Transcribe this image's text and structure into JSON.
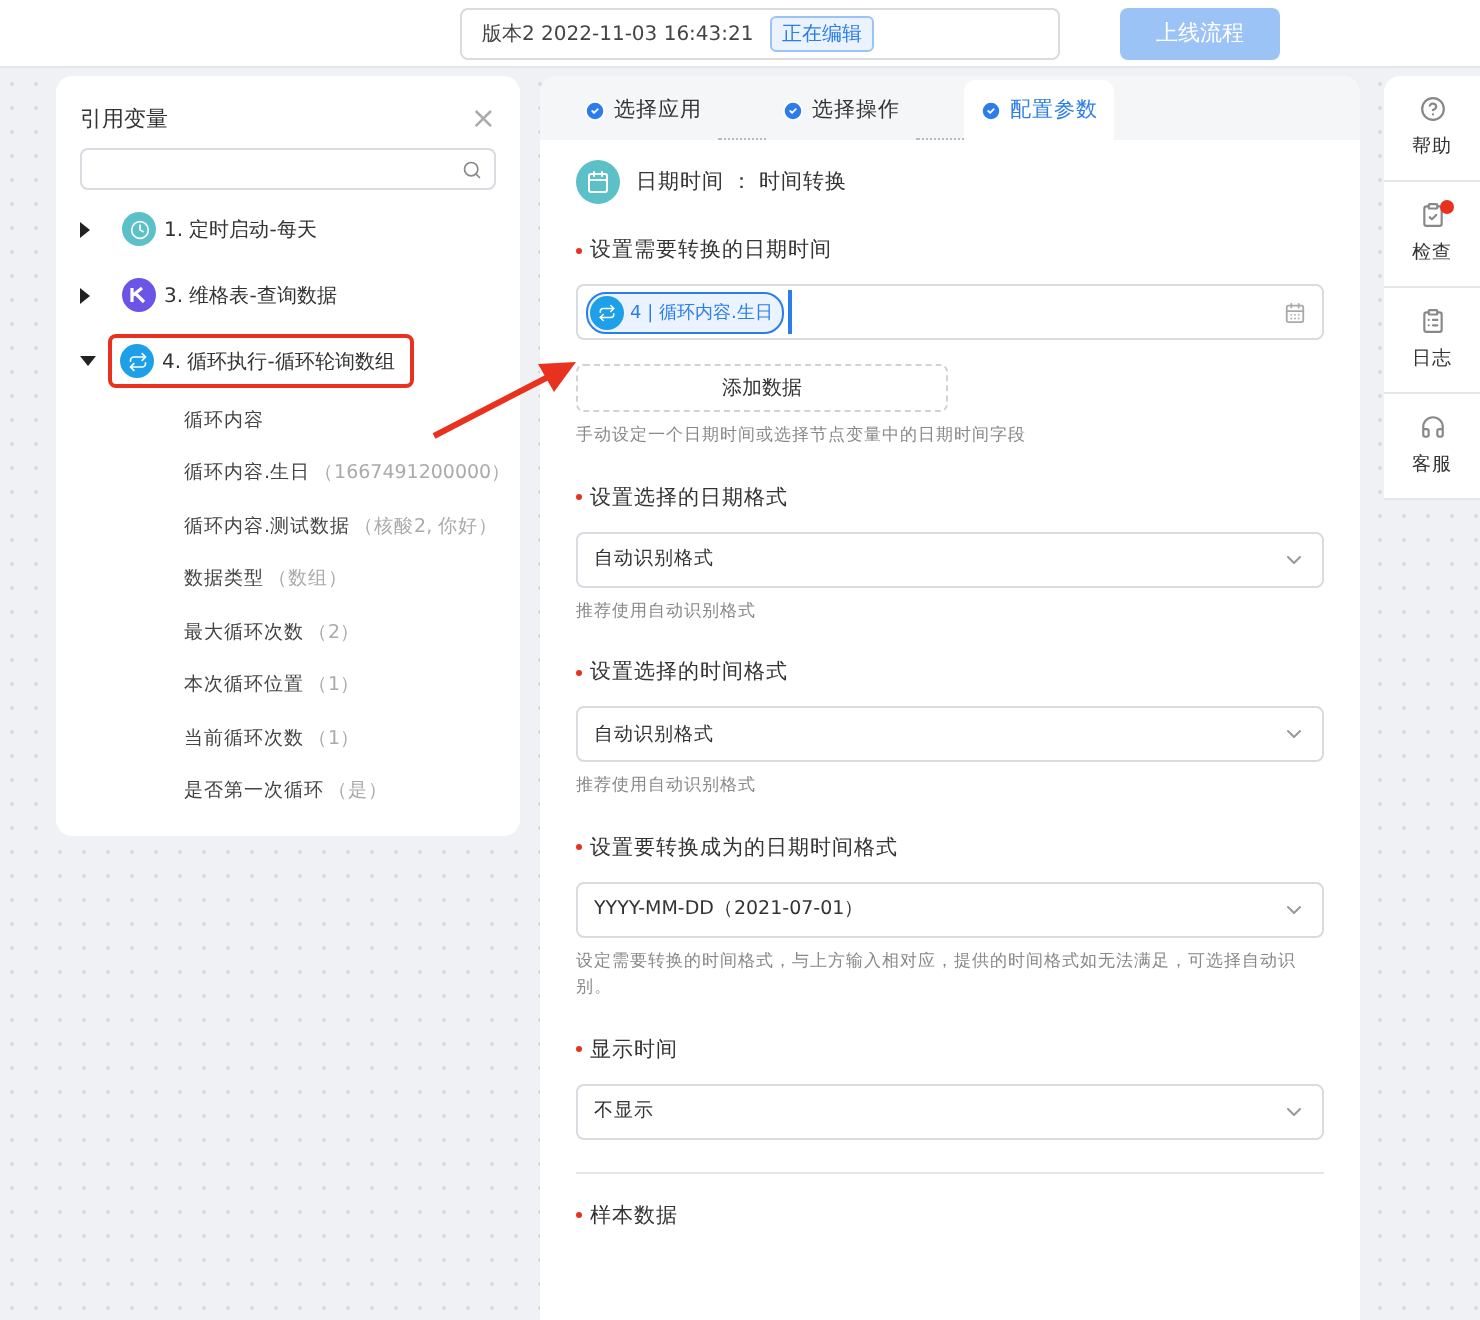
{
  "header": {
    "version": "版本2  2022-11-03 16:43:21",
    "status": "正在编辑",
    "publish_button": "上线流程"
  },
  "variables_panel": {
    "title": "引用变量",
    "close": "×",
    "nodes": [
      {
        "label": "1. 定时启动-每天",
        "kind": "timer",
        "expanded": false,
        "highlighted": false
      },
      {
        "label": "3. 维格表-查询数据",
        "kind": "table",
        "expanded": false,
        "highlighted": false
      },
      {
        "label": "4. 循环执行-循环轮询数组",
        "kind": "loop",
        "expanded": true,
        "highlighted": true,
        "children": [
          {
            "name": "循环内容"
          },
          {
            "name": "循环内容.生日",
            "value": "（1667491200000）"
          },
          {
            "name": "循环内容.测试数据",
            "value": "（核酸2, 你好）"
          },
          {
            "name": "数据类型",
            "value": "（数组）"
          },
          {
            "name": "最大循环次数",
            "value": "（2）"
          },
          {
            "name": "本次循环位置",
            "value": "（1）"
          },
          {
            "name": "当前循环次数",
            "value": "（1）"
          },
          {
            "name": "是否第一次循环",
            "value": "（是）"
          }
        ]
      }
    ]
  },
  "steps": [
    {
      "label": "选择应用",
      "selected": false
    },
    {
      "label": "选择操作",
      "selected": false
    },
    {
      "label": "配置参数",
      "selected": true
    }
  ],
  "action": {
    "app": "日期时间",
    "separator": "：",
    "operation": "时间转换"
  },
  "fields": [
    {
      "kind": "tokens",
      "label": "设置需要转换的日期时间",
      "required": true,
      "token": "4 | 循环内容.生日",
      "add_button": "添加数据",
      "hint": "手动设定一个日期时间或选择节点变量中的日期时间字段"
    },
    {
      "kind": "select",
      "label": "设置选择的日期格式",
      "required": true,
      "value": "自动识别格式",
      "hint": "推荐使用自动识别格式"
    },
    {
      "kind": "select",
      "label": "设置选择的时间格式",
      "required": true,
      "value": "自动识别格式",
      "hint": "推荐使用自动识别格式"
    },
    {
      "kind": "select",
      "label": "设置要转换成为的日期时间格式",
      "required": true,
      "value": "YYYY-MM-DD（2021-07-01）",
      "hint": "设定需要转换的时间格式，与上方输入相对应，提供的时间格式如无法满足，可选择自动识别。"
    },
    {
      "kind": "select",
      "label": "显示时间",
      "required": true,
      "value": "不显示"
    },
    {
      "kind": "section",
      "label": "样本数据",
      "required": true
    }
  ],
  "side_tools": [
    {
      "label": "帮助",
      "kind": "help",
      "alert": false
    },
    {
      "label": "检查",
      "kind": "check",
      "alert": true
    },
    {
      "label": "日志",
      "kind": "log",
      "alert": false
    },
    {
      "label": "客服",
      "kind": "support",
      "alert": false
    }
  ]
}
